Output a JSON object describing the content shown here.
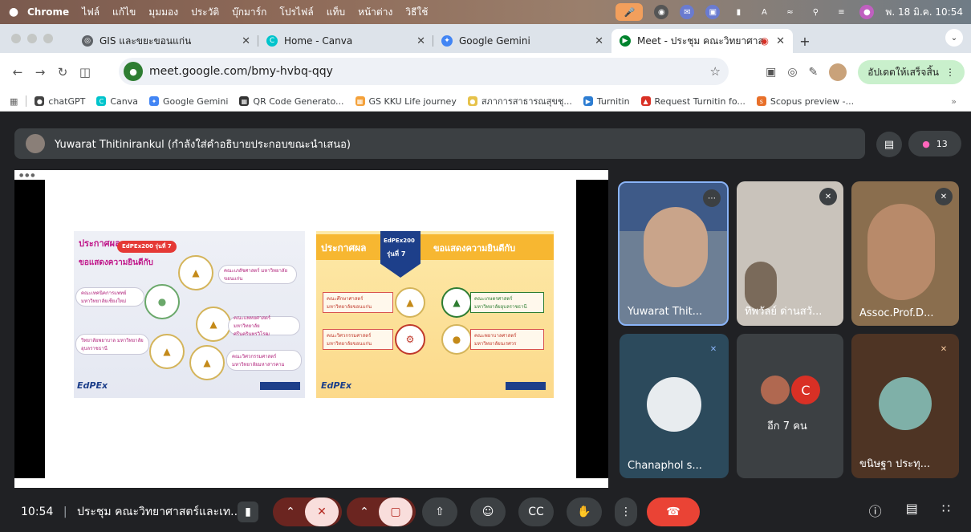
{
  "menubar": {
    "app": "Chrome",
    "items": [
      "ไฟล์",
      "แก้ไข",
      "มุมมอง",
      "ประวัติ",
      "บุ๊กมาร์ก",
      "โปรไฟล์",
      "แท็บ",
      "หน้าต่าง",
      "วิธีใช้"
    ],
    "clock": "พ. 18 มิ.ค. 10:54"
  },
  "tabs": [
    {
      "title": "GIS และขยะขอนแก่น",
      "color": "#5f6368",
      "icon": "globe-icon"
    },
    {
      "title": "Home - Canva",
      "color": "#00c4cc",
      "icon": "canva-icon"
    },
    {
      "title": "Google Gemini",
      "color": "#4285f4",
      "icon": "gemini-icon"
    },
    {
      "title": "Meet - ประชุม คณะวิทยาศาส",
      "color": "#00832d",
      "icon": "meet-icon",
      "active": true
    }
  ],
  "address": {
    "url": "meet.google.com/bmy-hvbq-qqy",
    "update_label": "อัปเดตให้เสร็จสิ้น"
  },
  "bookmarks": [
    {
      "label": "chatGPT",
      "color": "#444"
    },
    {
      "label": "Canva",
      "color": "#00c4cc"
    },
    {
      "label": "Google Gemini",
      "color": "#4285f4"
    },
    {
      "label": "QR Code Generato...",
      "color": "#333"
    },
    {
      "label": "GS KKU Life journey",
      "color": "#f4a13a"
    },
    {
      "label": "สภาการสาธารณสุขชุ...",
      "color": "#e6c24a"
    },
    {
      "label": "Turnitin",
      "color": "#2d7dd2"
    },
    {
      "label": "Request Turnitin fo...",
      "color": "#d93025"
    },
    {
      "label": "Scopus preview -...",
      "color": "#e8702a"
    }
  ],
  "meeting": {
    "presenter_text": "Yuwarat Thitinirankul (กำลังใส่คำอธิบายประกอบขณะนำเสนอ)",
    "people_count": "13"
  },
  "slide": {
    "left": {
      "title": "ประกาศผล",
      "badge": "EdPEx200 รุ่นที่ 7",
      "subtitle": "ขอแสดงความยินดีกับ",
      "orgs": [
        "คณะเภสัชศาสตร์ มหาวิทยาลัยขอนแก่น",
        "คณะเทคนิคการแพทย์ มหาวิทยาลัยเชียงใหม่",
        "คณะแพทยศาสตร์ มหาวิทยาลัยศรีนครินทรวิโรฒ",
        "วิทยาลัยพยาบาล มหาวิทยาลัยอุบลราชธานี",
        "คณะวิศวกรรมศาสตร์ มหาวิทยาลัยมหาสารคาม"
      ],
      "logo": "EdPEx"
    },
    "right": {
      "title": "ประกาศผล",
      "badge_top": "EdPEx200",
      "badge_bottom": "รุ่นที่ 7",
      "subtitle": "ขอแสดงความยินดีกับ",
      "orgs": [
        "คณะศึกษาศาสตร์ มหาวิทยาลัยขอนแก่น",
        "คณะเกษตรศาสตร์ มหาวิทยาลัยอุบลราชธานี",
        "คณะวิศวกรรมศาสตร์ มหาวิทยาลัยขอนแก่น",
        "คณะพยาบาลศาสตร์ มหาวิทยาลัยนเรศวร"
      ],
      "logo": "EdPEx"
    }
  },
  "participants": [
    {
      "name": "Yuwarat Thit...",
      "bg": "#6d7f95"
    },
    {
      "name": "ทิพวัลย์ ด่านสวั...",
      "bg": "#c9c3bb"
    },
    {
      "name": "Assoc.Prof.D...",
      "bg": "#8a6e4e"
    },
    {
      "name": "Chanaphol s...",
      "bg": "#2c4a5c"
    },
    {
      "name": "อีก 7 คน",
      "bg": "#3c4043",
      "avatar": "C"
    },
    {
      "name": "ขนิษฐา ประทุ...",
      "bg": "#4e3424"
    }
  ],
  "toolbar": {
    "time": "10:54",
    "title": "ประชุม คณะวิทยาศาสตร์และเท..."
  }
}
